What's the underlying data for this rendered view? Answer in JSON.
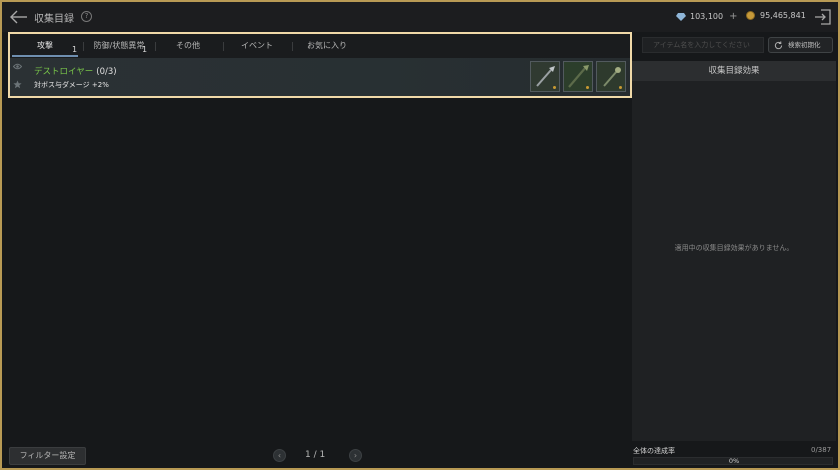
{
  "header": {
    "title": "収集目録",
    "help": "?",
    "gems": "103,100",
    "gems_add": "+",
    "gold": "95,465,841"
  },
  "tabs": [
    {
      "label": "攻撃",
      "count": "1",
      "active": true
    },
    {
      "label": "防御/状態異常",
      "count": "1",
      "active": false
    },
    {
      "label": "その他",
      "count": "",
      "active": false
    },
    {
      "label": "イベント",
      "count": "",
      "active": false
    },
    {
      "label": "お気に入り",
      "count": "",
      "active": false
    }
  ],
  "collection": {
    "name": "デストロイヤー",
    "progress": "(0/3)",
    "effect": "対ボス与ダメージ +2%",
    "items": [
      {
        "icon": "spear-item-icon",
        "slot_color": "#2f3a30"
      },
      {
        "icon": "polearm-item-icon",
        "slot_color": "#2b3d2a"
      },
      {
        "icon": "staff-item-icon",
        "slot_color": "#2d3a2c"
      }
    ]
  },
  "search": {
    "placeholder": "アイテム名を入力してください",
    "reset_label": "検索初期化"
  },
  "effect_panel": {
    "title": "収集目録効果",
    "empty_text": "適用中の収集目録効果がありません。"
  },
  "footer": {
    "filter_label": "フィルター設定",
    "page": "1 / 1",
    "prev": "‹",
    "next": "›",
    "rate_label": "全体の達成率",
    "rate_count": "0/387",
    "rate_percent": "0%",
    "rate_value": 0
  },
  "colors": {
    "frame": "#b89a54",
    "highlight": "#f0d9a8",
    "collection_name": "#79c64a"
  }
}
